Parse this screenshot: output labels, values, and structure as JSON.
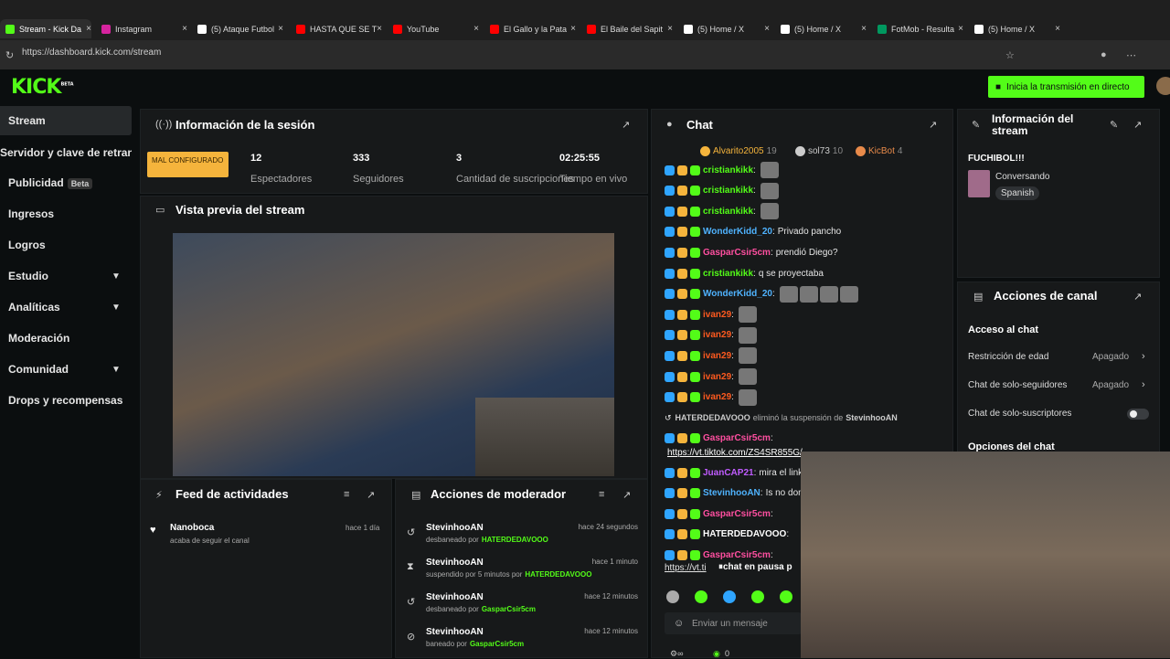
{
  "browser": {
    "tabs": [
      {
        "label": "Stream - Kick Da",
        "color": "#53fc18"
      },
      {
        "label": "Instagram",
        "color": "#d6249f"
      },
      {
        "label": "(5) Ataque Futbol",
        "color": "#ffffff"
      },
      {
        "label": "HASTA QUE SE T",
        "color": "#ff0000"
      },
      {
        "label": "YouTube",
        "color": "#ff0000"
      },
      {
        "label": "El Gallo y la Pata",
        "color": "#ff0000"
      },
      {
        "label": "El Baile del Sapit",
        "color": "#ff0000"
      },
      {
        "label": "(5) Home / X",
        "color": "#ffffff"
      },
      {
        "label": "(5) Home / X",
        "color": "#ffffff"
      },
      {
        "label": "FotMob - Resulta",
        "color": "#00985f"
      },
      {
        "label": "(5) Home / X",
        "color": "#ffffff"
      }
    ],
    "url": "https://dashboard.kick.com/stream"
  },
  "app": {
    "logo": "KICK",
    "logo_sup": "BETA",
    "go_live": "Inicia la transmisión en directo"
  },
  "sidebar": {
    "items": [
      {
        "label": "Stream"
      },
      {
        "label": "Servidor y clave de retransmisión"
      },
      {
        "label": "Publicidad",
        "badge": "Beta"
      },
      {
        "label": "Ingresos"
      },
      {
        "label": "Logros"
      },
      {
        "label": "Estudio"
      },
      {
        "label": "Analíticas"
      },
      {
        "label": "Moderación"
      },
      {
        "label": "Comunidad"
      },
      {
        "label": "Drops y recompensas"
      }
    ]
  },
  "session": {
    "title": "Información de la sesión",
    "status": "MAL CONFIGURADO",
    "stats": [
      {
        "value": "12",
        "label": "Espectadores"
      },
      {
        "value": "333",
        "label": "Seguidores"
      },
      {
        "value": "3",
        "label": "Cantidad de suscripciones"
      },
      {
        "value": "02:25:55",
        "label": "Tiempo en vivo"
      }
    ]
  },
  "preview": {
    "title": "Vista previa del stream"
  },
  "feed": {
    "title": "Feed de actividades",
    "items": [
      {
        "name": "Nanoboca",
        "sub": "acaba de seguir el canal",
        "time": "hace 1 día"
      }
    ]
  },
  "modactions": {
    "title": "Acciones de moderador",
    "items": [
      {
        "name": "StevinhooAN",
        "action": "desbaneado por",
        "by": "HATERDEDAVOOO",
        "time": "hace 24 segundos"
      },
      {
        "name": "StevinhooAN",
        "action": "suspendido por 5 minutos por",
        "by": "HATERDEDAVOOO",
        "time": "hace 1 minuto"
      },
      {
        "name": "StevinhooAN",
        "action": "desbaneado por",
        "by": "GasparCsir5cm",
        "time": "hace 12 minutos"
      },
      {
        "name": "StevinhooAN",
        "action": "baneado por",
        "by": "GasparCsir5cm",
        "time": "hace 12 minutos"
      }
    ]
  },
  "chat": {
    "title": "Chat",
    "top": [
      {
        "name": "Alvarito2005",
        "count": "19"
      },
      {
        "name": "sol73",
        "count": "10"
      },
      {
        "name": "KicBot",
        "count": "4"
      }
    ],
    "lines": [
      {
        "user": "cristiankikk",
        "text": "",
        "color": "#53fc18",
        "emote": true
      },
      {
        "user": "cristiankikk",
        "text": "",
        "color": "#53fc18",
        "emote": true
      },
      {
        "user": "cristiankikk",
        "text": "",
        "color": "#53fc18",
        "emote": true
      },
      {
        "user": "WonderKidd_20",
        "text": "Privado pancho",
        "color": "#4fb3ff"
      },
      {
        "user": "GasparCsir5cm",
        "text": "prendió Diego?",
        "color": "#ff4fa0"
      },
      {
        "user": "cristiankikk",
        "text": "q se proyectaba",
        "color": "#53fc18"
      },
      {
        "user": "WonderKidd_20",
        "text": "",
        "color": "#4fb3ff",
        "emote": true
      },
      {
        "user": "ivan29",
        "text": "",
        "color": "#ff5a1f",
        "emote": true
      },
      {
        "user": "ivan29",
        "text": "",
        "color": "#ff5a1f",
        "emote": true
      },
      {
        "user": "ivan29",
        "text": "",
        "color": "#ff5a1f",
        "emote": true
      },
      {
        "user": "ivan29",
        "text": "",
        "color": "#ff5a1f",
        "emote": true
      },
      {
        "user": "ivan29",
        "text": "",
        "color": "#ff5a1f",
        "emote": true
      }
    ],
    "system": {
      "user": "HATERDEDAVOOO",
      "text": "eliminó la suspensión de",
      "target": "StevinhooAN"
    },
    "lines2": [
      {
        "user": "GasparCsir5cm",
        "text": "",
        "color": "#ff4fa0"
      },
      {
        "user": "",
        "text": "https://vt.tiktok.com/ZS4SR855G/",
        "color": "#ffffff"
      },
      {
        "user": "JuanCAP21",
        "text": "mira el link puta",
        "color": "#c05cff"
      },
      {
        "user": "StevinhooAN",
        "text": "Is no dome st",
        "color": "#4fb3ff"
      },
      {
        "user": "GasparCsir5cm",
        "text": "",
        "color": "#ff4fa0"
      },
      {
        "user": "HATERDEDAVOOO",
        "text": "",
        "color": "#ffffff"
      },
      {
        "user": "GasparCsir5cm",
        "text": "",
        "color": "#ff4fa0"
      }
    ],
    "paused": "chat en pausa p",
    "link2": "https://vt.ti",
    "input_placeholder": "Enviar un mensaje",
    "count": "0"
  },
  "streaminfo": {
    "title": "Información del stream",
    "stream_title": "FUCHIBOL!!!",
    "category": "Conversando",
    "language": "Spanish"
  },
  "channel": {
    "title": "Acciones de canal",
    "section": "Acceso al chat",
    "rows": [
      {
        "label": "Restricción de edad",
        "value": "Apagado"
      },
      {
        "label": "Chat de solo-seguidores",
        "value": "Apagado"
      },
      {
        "label": "Chat de solo-suscriptores",
        "value": ""
      }
    ],
    "section2": "Opciones del chat"
  }
}
